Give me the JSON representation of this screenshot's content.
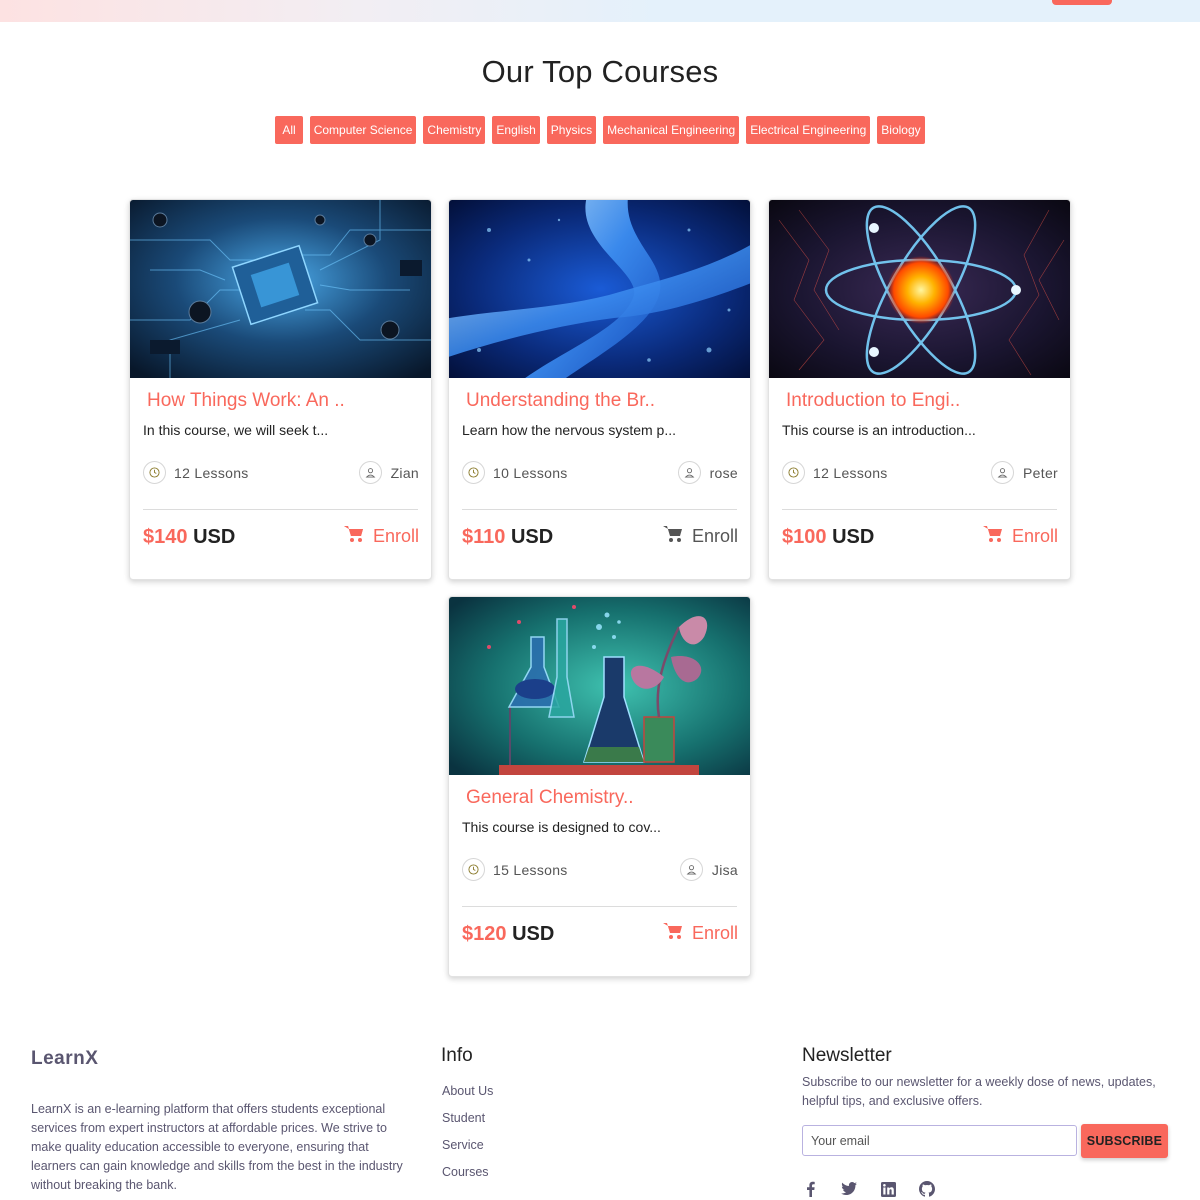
{
  "header": {
    "action_label": ""
  },
  "section": {
    "title": "Our Top Courses"
  },
  "filters": [
    "All",
    "Computer Science",
    "Chemistry",
    "English",
    "Physics",
    "Mechanical Engineering",
    "Electrical Engineering",
    "Biology"
  ],
  "accent_color": "#f9685c",
  "courses": [
    {
      "title": "How Things Work: An ..",
      "description": "In this course, we will seek t...",
      "lessons": "12 Lessons",
      "instructor": "Zian",
      "price_amount": "$140",
      "price_currency": "USD",
      "enroll_label": "Enroll",
      "image": "circuit-board-image"
    },
    {
      "title": "Understanding the Br..",
      "description": "Learn how the nervous system p...",
      "lessons": "10 Lessons",
      "instructor": "rose",
      "price_amount": "$110",
      "price_currency": "USD",
      "enroll_label": "Enroll",
      "image": "chromosome-image"
    },
    {
      "title": "Introduction to Engi..",
      "description": "This course is an introduction...",
      "lessons": "12 Lessons",
      "instructor": "Peter",
      "price_amount": "$100",
      "price_currency": "USD",
      "enroll_label": "Enroll",
      "image": "atom-image"
    },
    {
      "title": "General Chemistry..",
      "description": "This course is designed to cov...",
      "lessons": "15 Lessons",
      "instructor": "Jisa",
      "price_amount": "$120",
      "price_currency": "USD",
      "enroll_label": "Enroll",
      "image": "chemistry-lab-image"
    }
  ],
  "footer": {
    "brand": "LearnX",
    "about": "LearnX is an e-learning platform that offers students exceptional services from expert instructors at affordable prices. We strive to make quality education accessible to everyone, ensuring that learners can gain knowledge and skills from the best in the industry without breaking the bank.",
    "info_title": "Info",
    "info_links": [
      "About Us",
      "Student",
      "Service",
      "Courses"
    ],
    "newsletter_title": "Newsletter",
    "newsletter_desc": "Subscribe to our newsletter for a weekly dose of news, updates, helpful tips, and exclusive offers.",
    "email_placeholder": "Your email",
    "subscribe_label": "SUBSCRIBE",
    "socials": [
      "facebook-icon",
      "twitter-icon",
      "linkedin-icon",
      "github-icon"
    ]
  }
}
